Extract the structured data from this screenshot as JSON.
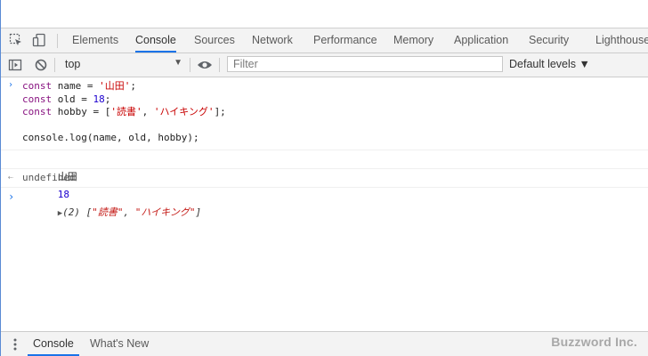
{
  "tabs": [
    {
      "label": "Elements",
      "active": false
    },
    {
      "label": "Console",
      "active": true
    },
    {
      "label": "Sources",
      "active": false
    },
    {
      "label": "Network",
      "active": false
    },
    {
      "label": "Performance",
      "active": false
    },
    {
      "label": "Memory",
      "active": false
    },
    {
      "label": "Application",
      "active": false
    },
    {
      "label": "Security",
      "active": false
    },
    {
      "label": "Lighthouse",
      "active": false
    }
  ],
  "toolbar": {
    "context": "top",
    "filter_placeholder": "Filter",
    "levels": "Default levels ▼"
  },
  "console": {
    "input_lines": [
      [
        {
          "t": "const ",
          "c": "kw"
        },
        {
          "t": "name = ",
          "c": ""
        },
        {
          "t": "'山田'",
          "c": "str"
        },
        {
          "t": ";",
          "c": ""
        }
      ],
      [
        {
          "t": "const ",
          "c": "kw"
        },
        {
          "t": "old = ",
          "c": ""
        },
        {
          "t": "18",
          "c": "num"
        },
        {
          "t": ";",
          "c": ""
        }
      ],
      [
        {
          "t": "const ",
          "c": "kw"
        },
        {
          "t": "hobby = [",
          "c": ""
        },
        {
          "t": "'読書'",
          "c": "str"
        },
        {
          "t": ", ",
          "c": ""
        },
        {
          "t": "'ハイキング'",
          "c": "str"
        },
        {
          "t": "];",
          "c": ""
        }
      ],
      [
        {
          "t": "",
          "c": ""
        }
      ],
      [
        {
          "t": "console.log(name, old, hobby);",
          "c": ""
        }
      ]
    ],
    "output": {
      "name": "山田",
      "old": "18",
      "array_prefix": "(2) [",
      "item1": "\"読書\"",
      "comma": ", ",
      "item2": "\"ハイキング\"",
      "array_suffix": "]"
    },
    "result": "undefined"
  },
  "drawer": {
    "tabs": [
      {
        "label": "Console",
        "active": true
      },
      {
        "label": "What's New",
        "active": false
      }
    ]
  },
  "watermark": "Buzzword Inc.",
  "colors": {
    "accent": "#1a73e8",
    "keyword": "#881280",
    "string": "#c80000",
    "number": "#1c00cf"
  }
}
